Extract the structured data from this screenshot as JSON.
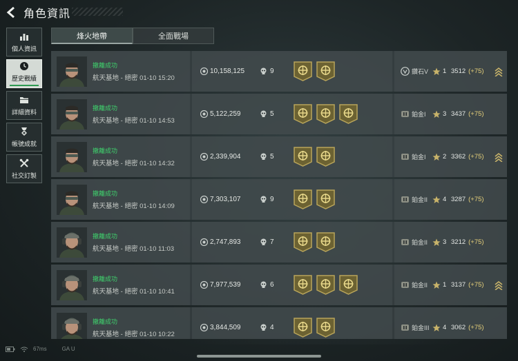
{
  "header": {
    "title": "角色資訊",
    "back_icon": "chevron-left-icon"
  },
  "sidebar": {
    "items": [
      {
        "label": "個人資訊",
        "icon": "bar-chart-icon",
        "active": false
      },
      {
        "label": "歷史戰績",
        "icon": "clock-icon",
        "active": true
      },
      {
        "label": "詳細資料",
        "icon": "folder-icon",
        "active": false
      },
      {
        "label": "帳號成就",
        "icon": "medal-icon",
        "active": false
      },
      {
        "label": "社交訂製",
        "icon": "tools-icon",
        "active": false
      }
    ]
  },
  "tabs": [
    {
      "label": "烽火地帶",
      "active": true
    },
    {
      "label": "全面戰場",
      "active": false
    }
  ],
  "matches": [
    {
      "avatar": "avatar-goggles",
      "status": "撤離成功",
      "map": "航天基地 - 絕密 01-10 15:20",
      "money": "10,158,125",
      "kills": "9",
      "badges": 2,
      "rank_icon": "diamond-rank-icon",
      "tier": "鑽石V",
      "stars": "1",
      "score": "3512",
      "delta": "(+75)",
      "chevron": true
    },
    {
      "avatar": "avatar-goggles",
      "status": "撤離成功",
      "map": "航天基地 - 絕密 01-10 14:53",
      "money": "5,122,259",
      "kills": "5",
      "badges": 3,
      "rank_icon": "platinum-rank-icon",
      "tier": "鉑金I",
      "stars": "3",
      "score": "3437",
      "delta": "(+75)",
      "chevron": false
    },
    {
      "avatar": "avatar-goggles",
      "status": "撤離成功",
      "map": "航天基地 - 絕密 01-10 14:32",
      "money": "2,339,904",
      "kills": "5",
      "badges": 2,
      "rank_icon": "platinum-rank-icon",
      "tier": "鉑金I",
      "stars": "2",
      "score": "3362",
      "delta": "(+75)",
      "chevron": true
    },
    {
      "avatar": "avatar-goggles",
      "status": "撤離成功",
      "map": "航天基地 - 絕密 01-10 14:09",
      "money": "7,303,107",
      "kills": "9",
      "badges": 2,
      "rank_icon": "platinum-rank-icon",
      "tier": "鉑金II",
      "stars": "4",
      "score": "3287",
      "delta": "(+75)",
      "chevron": false
    },
    {
      "avatar": "avatar-headset",
      "status": "撤離成功",
      "map": "航天基地 - 絕密 01-10 11:03",
      "money": "2,747,893",
      "kills": "7",
      "badges": 2,
      "rank_icon": "platinum-rank-icon",
      "tier": "鉑金II",
      "stars": "3",
      "score": "3212",
      "delta": "(+75)",
      "chevron": false
    },
    {
      "avatar": "avatar-headset",
      "status": "撤離成功",
      "map": "航天基地 - 絕密 01-10 10:41",
      "money": "7,977,539",
      "kills": "6",
      "badges": 3,
      "rank_icon": "platinum-rank-icon",
      "tier": "鉑金II",
      "stars": "1",
      "score": "3137",
      "delta": "(+75)",
      "chevron": true
    },
    {
      "avatar": "avatar-headset",
      "status": "撤離成功",
      "map": "航天基地 - 絕密 01-10 10:22",
      "money": "3,844,509",
      "kills": "4",
      "badges": 2,
      "rank_icon": "platinum-rank-icon",
      "tier": "鉑金III",
      "stars": "4",
      "score": "3062",
      "delta": "(+75)",
      "chevron": false
    }
  ],
  "statusbar": {
    "ping": "67ms",
    "tag": "GA U"
  },
  "colors": {
    "success": "#3fd36d",
    "gold": "#b8a45a",
    "delta": "#e6d07a",
    "active_tab_underline": "#2e9a52"
  }
}
